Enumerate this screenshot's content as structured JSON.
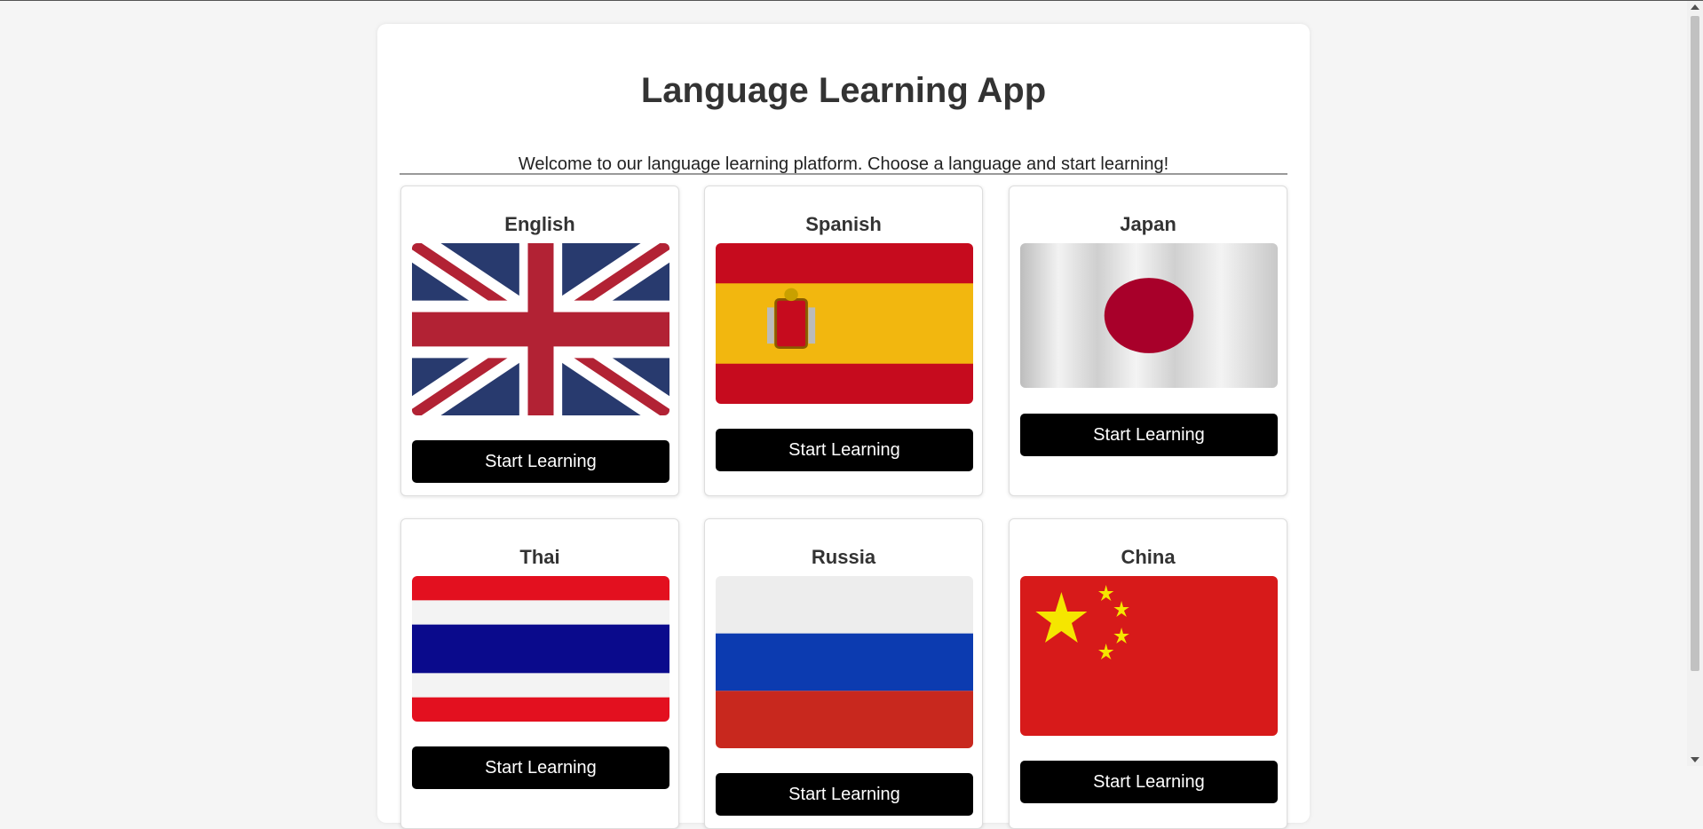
{
  "page": {
    "title": "Language Learning App",
    "intro": "Welcome to our language learning platform. Choose a language and start learning!"
  },
  "cards": [
    {
      "name": "English",
      "button": "Start Learning",
      "flag": "united-kingdom-flag"
    },
    {
      "name": "Spanish",
      "button": "Start Learning",
      "flag": "spain-flag"
    },
    {
      "name": "Japan",
      "button": "Start Learning",
      "flag": "japan-flag"
    },
    {
      "name": "Thai",
      "button": "Start Learning",
      "flag": "thailand-flag"
    },
    {
      "name": "Russia",
      "button": "Start Learning",
      "flag": "russia-flag"
    },
    {
      "name": "China",
      "button": "Start Learning",
      "flag": "china-flag"
    }
  ],
  "colors": {
    "background": "#f5f5f5",
    "card": "#ffffff",
    "button": "#000000",
    "button_text": "#ffffff",
    "text": "#333333"
  }
}
